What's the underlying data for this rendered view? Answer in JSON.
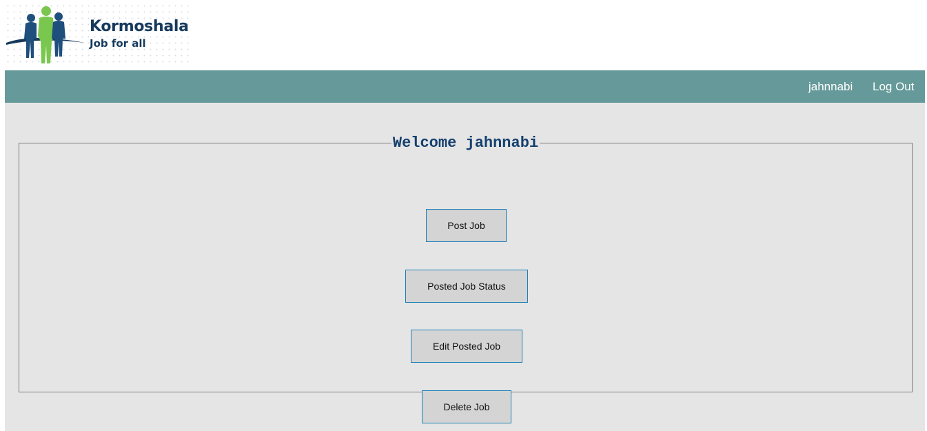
{
  "brand": {
    "name": "Kormoshala",
    "tagline": "Job for all",
    "colors": {
      "navy": "#173a5c",
      "green": "#7ac74f"
    }
  },
  "navbar": {
    "background": "#669a9a",
    "username": "jahnnabi",
    "logout_label": "Log Out"
  },
  "panel": {
    "welcome_text": "Welcome jahnnabi"
  },
  "actions": {
    "post_job": "Post Job",
    "posted_job_status": "Posted Job Status",
    "edit_posted_job": "Edit Posted Job",
    "delete_job": "Delete Job"
  }
}
